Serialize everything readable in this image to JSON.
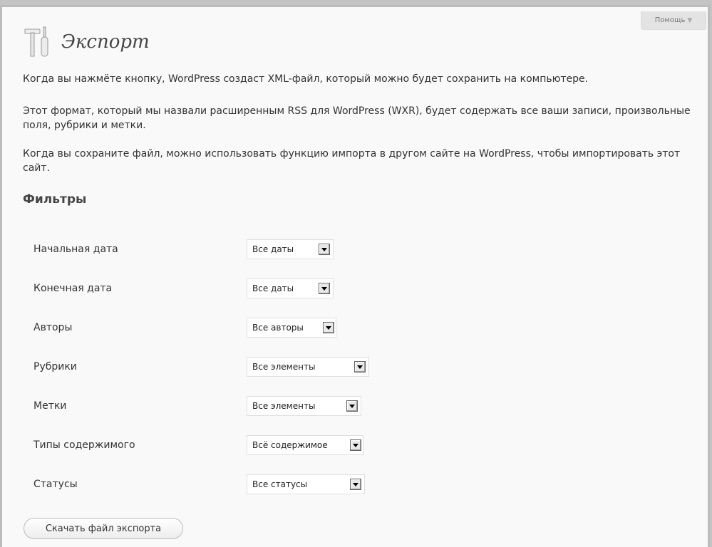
{
  "help": {
    "label": "Помощь"
  },
  "page": {
    "title": "Экспорт"
  },
  "paragraphs": {
    "p1": "Когда вы нажмёте кнопку, WordPress создаст XML-файл, который можно будет сохранить на компьютере.",
    "p2": "Этот формат, который мы назвали расширенным RSS для WordPress (WXR), будет содержать все ваши записи, произвольные поля, рубрики и метки.",
    "p3": "Когда вы сохраните файл, можно использовать функцию импорта в другом сайте на WordPress, чтобы импортировать этот сайт."
  },
  "filters": {
    "heading": "Фильтры",
    "start_date": {
      "label": "Начальная дата",
      "value": "Все даты"
    },
    "end_date": {
      "label": "Конечная дата",
      "value": "Все даты"
    },
    "authors": {
      "label": "Авторы",
      "value": "Все авторы"
    },
    "categories": {
      "label": "Рубрики",
      "value": "Все элементы"
    },
    "tags": {
      "label": "Метки",
      "value": "Все элементы"
    },
    "content_types": {
      "label": "Типы содержимого",
      "value": "Всё содержимое"
    },
    "statuses": {
      "label": "Статусы",
      "value": "Все статусы"
    }
  },
  "actions": {
    "download_label": "Скачать файл экспорта"
  },
  "icons": {
    "tools": "tools-icon",
    "help_arrow": "triangle-down-icon",
    "select_arrow": "triangle-down-icon"
  }
}
